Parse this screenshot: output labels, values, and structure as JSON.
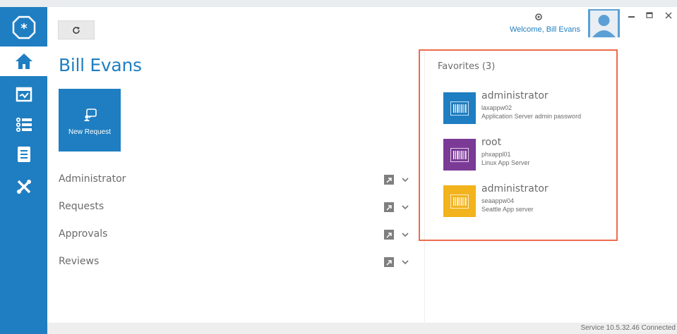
{
  "window": {
    "welcome_text": "Welcome, Bill Evans"
  },
  "toolbar": {
    "refresh_icon": "refresh-icon"
  },
  "rail": {
    "items": [
      "app-logo-icon",
      "home-icon",
      "calendar-check-icon",
      "list-icon",
      "document-icon",
      "tools-icon"
    ]
  },
  "main": {
    "user_name": "Bill Evans",
    "new_request_label": "New Request",
    "sections": [
      {
        "label": "Administrator"
      },
      {
        "label": "Requests"
      },
      {
        "label": "Approvals"
      },
      {
        "label": "Reviews"
      }
    ]
  },
  "favorites": {
    "title": "Favorites (3)",
    "items": [
      {
        "name": "administrator",
        "host": "laxappw02",
        "description": "Application Server admin password",
        "color": "#1f7ec1"
      },
      {
        "name": "root",
        "host": "phxappl01",
        "description": "Linux App Server",
        "color": "#7b3a96"
      },
      {
        "name": "administrator",
        "host": "seaappw04",
        "description": "Seattle App server",
        "color": "#f2b31c"
      }
    ]
  },
  "status": {
    "text": "Service 10.5.32.46 Connected"
  },
  "colors": {
    "accent": "#1f7ec1",
    "highlight_border": "#ee6c4d"
  }
}
